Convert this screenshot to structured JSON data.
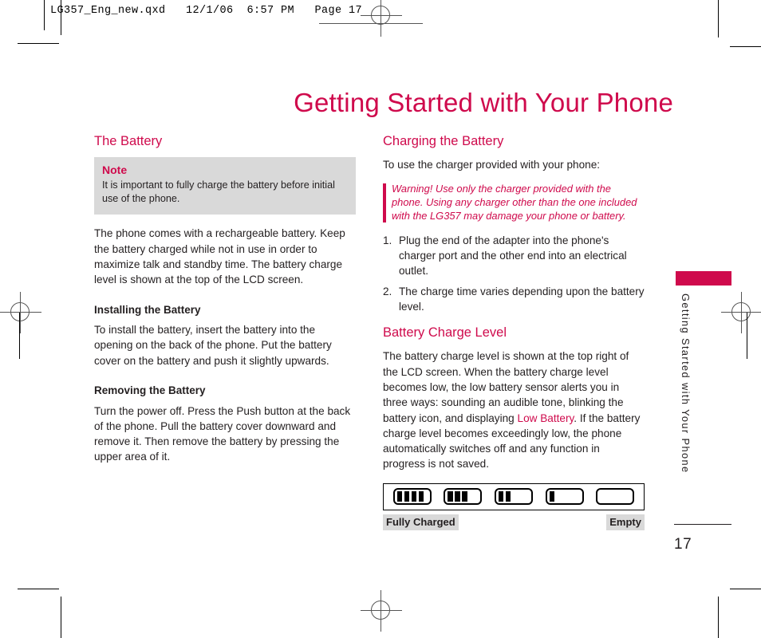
{
  "slug": {
    "text": "LG357_Eng_new.qxd   12/1/06  6:57 PM   Page 17"
  },
  "page": {
    "title": "Getting Started with Your Phone",
    "folio": "17",
    "side_tab_text": "Getting Started with Your Phone"
  },
  "left_column": {
    "heading": "The Battery",
    "note": {
      "title": "Note",
      "text": "It is important to fully charge the battery before initial use of the phone."
    },
    "intro": "The phone comes with a rechargeable battery. Keep the battery charged while not in use in order to maximize talk and standby time. The battery charge level is shown at the top of the LCD screen.",
    "installing_heading": "Installing the Battery",
    "installing_text": "To install the battery, insert the battery into the opening on the back of the phone. Put the battery cover on the battery and push it slightly upwards.",
    "removing_heading": "Removing the Battery",
    "removing_text": "Turn the power off. Press the Push button at the back of the phone. Pull the battery cover downward and remove it. Then remove the battery by pressing the upper area of it."
  },
  "right_column": {
    "heading": "Charging the Battery",
    "intro": "To use the charger provided with your phone:",
    "warning": "Warning! Use only the charger provided with the phone. Using any charger other than the one included with the LG357 may damage your phone or battery.",
    "steps": [
      {
        "num": "1.",
        "text": "Plug the end of the adapter into the phone's charger port and the other end into an electrical outlet."
      },
      {
        "num": "2.",
        "text": "The charge time varies depending upon the battery level."
      }
    ],
    "charge_level_heading": "Battery Charge Level",
    "charge_level_text_1": "The battery charge level is shown at the top right of the LCD screen. When the battery charge level becomes low, the low battery sensor alerts you in three ways: sounding an audible tone, blinking the battery icon, and displaying ",
    "charge_level_highlight": "Low Battery",
    "charge_level_text_2": ". If the battery charge level becomes exceedingly low, the phone automatically switches off and any function in progress is not saved.",
    "battery_diagram": {
      "levels": [
        4,
        3,
        2,
        1,
        0
      ],
      "label_left": "Fully Charged",
      "label_right": "Empty"
    }
  },
  "colors": {
    "accent": "#cf0a4c",
    "note_bg": "#d9d9d9",
    "text": "#231f20"
  }
}
